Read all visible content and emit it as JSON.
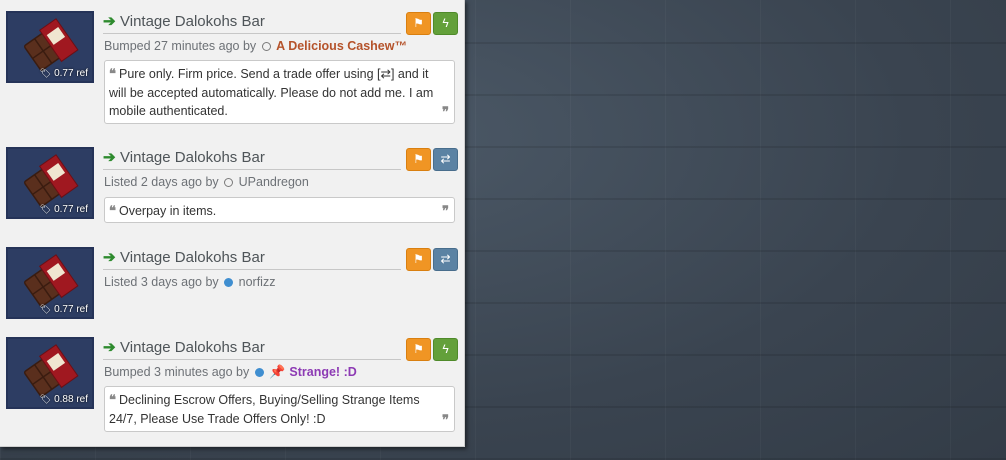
{
  "listings": [
    {
      "item_name": "Vintage Dalokohs Bar",
      "ref": "0.77 ref",
      "status": "Bumped 27 minutes ago by",
      "user": "A Delicious Cashew™",
      "comment": "Pure only. Firm price. Send a trade offer using [⇄] and it will be accepted automatically. Please do not add me. I am mobile authenticated.",
      "flag_icon": "flag-icon",
      "action_icon": "lightning-icon"
    },
    {
      "item_name": "Vintage Dalokohs Bar",
      "ref": "0.77 ref",
      "status": "Listed 2 days ago by",
      "user": "UPandregon",
      "comment": "Overpay in items.",
      "flag_icon": "flag-icon",
      "action_icon": "trade-arrows-icon"
    },
    {
      "item_name": "Vintage Dalokohs Bar",
      "ref": "0.77 ref",
      "status": "Listed 3 days ago by",
      "user": "norfizz",
      "flag_icon": "flag-icon",
      "action_icon": "trade-arrows-icon"
    },
    {
      "item_name": "Vintage Dalokohs Bar",
      "ref": "0.88 ref",
      "status": "Bumped 3 minutes ago by",
      "user": "Strange! :D",
      "comment": "Declining Escrow Offers, Buying/Selling Strange Items 24/7, Please Use Trade Offers Only! :D",
      "flag_icon": "flag-icon",
      "action_icon": "lightning-icon"
    }
  ],
  "colors": {
    "flag_button": "#f09524",
    "lightning_button": "#63a03a",
    "trade_button": "#5b82a3",
    "item_name": "#4e5458",
    "arrow": "#2e8b2e"
  }
}
